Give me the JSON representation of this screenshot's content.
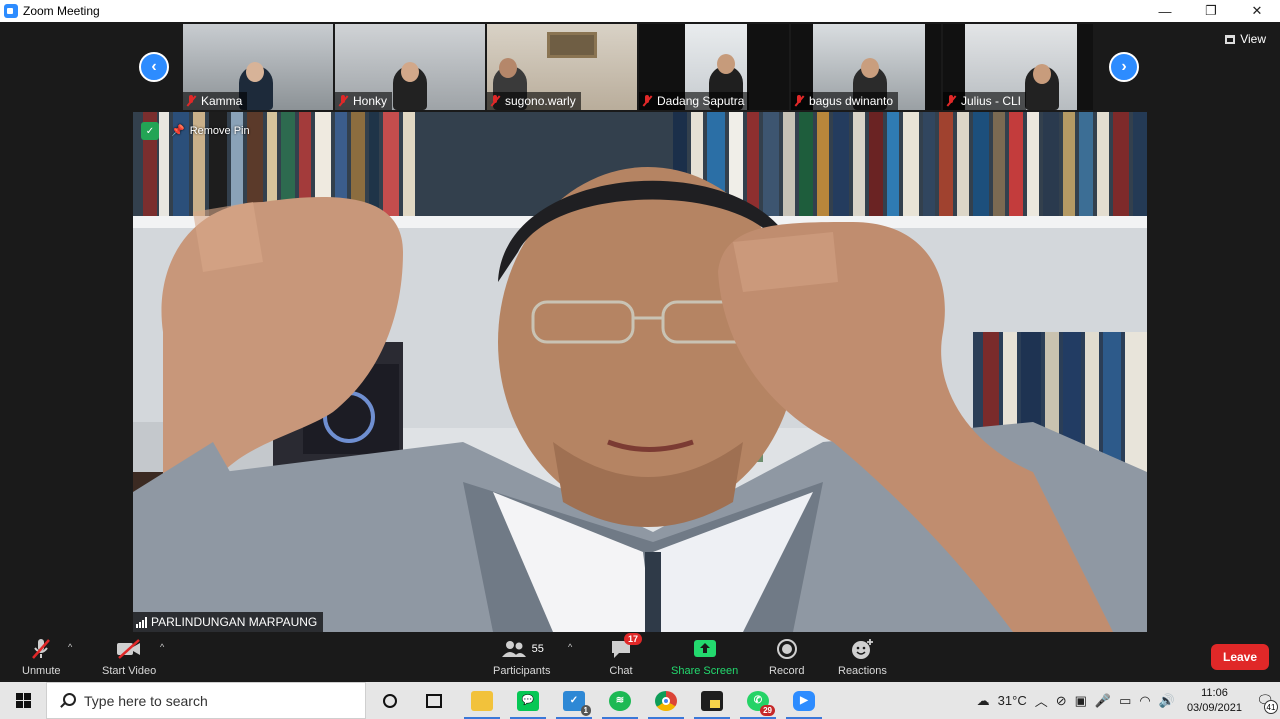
{
  "window": {
    "title": "Zoom Meeting",
    "minimize_glyph": "—",
    "restore_glyph": "❐",
    "close_glyph": "✕"
  },
  "gallery": {
    "prev_glyph": "‹",
    "next_glyph": "›",
    "view_label": "View",
    "participants": [
      {
        "name": "Kamma"
      },
      {
        "name": "Honky"
      },
      {
        "name": "sugono.warly"
      },
      {
        "name": "Dadang Saputra"
      },
      {
        "name": "bagus dwinanto"
      },
      {
        "name": "Julius - CLI"
      }
    ]
  },
  "main_video": {
    "remove_pin_label": "Remove Pin",
    "speaker_name": "PARLINDUNGAN MARPAUNG"
  },
  "toolbar": {
    "unmute_label": "Unmute",
    "start_video_label": "Start Video",
    "participants_label": "Participants",
    "participants_count": "55",
    "chat_label": "Chat",
    "chat_badge": "17",
    "share_screen_label": "Share Screen",
    "record_label": "Record",
    "reactions_label": "Reactions",
    "leave_label": "Leave",
    "caret_glyph": "^",
    "accent_color": "#2d8cff",
    "share_color": "#23d96e",
    "leave_color": "#e02828"
  },
  "taskbar": {
    "search_placeholder": "Type here to search",
    "apps": [
      {
        "icon": "task-view-icon"
      },
      {
        "icon": "file-explorer-icon"
      },
      {
        "icon": "line-icon"
      },
      {
        "icon": "vscode-icon",
        "badge": "1"
      },
      {
        "icon": "spotify-icon"
      },
      {
        "icon": "chrome-icon"
      },
      {
        "icon": "sticky-notes-icon"
      },
      {
        "icon": "whatsapp-icon",
        "badge": "29"
      },
      {
        "icon": "zoom-icon"
      }
    ],
    "weather": "31°C",
    "time": "11:06",
    "date": "03/09/2021",
    "notification_count": "41"
  }
}
